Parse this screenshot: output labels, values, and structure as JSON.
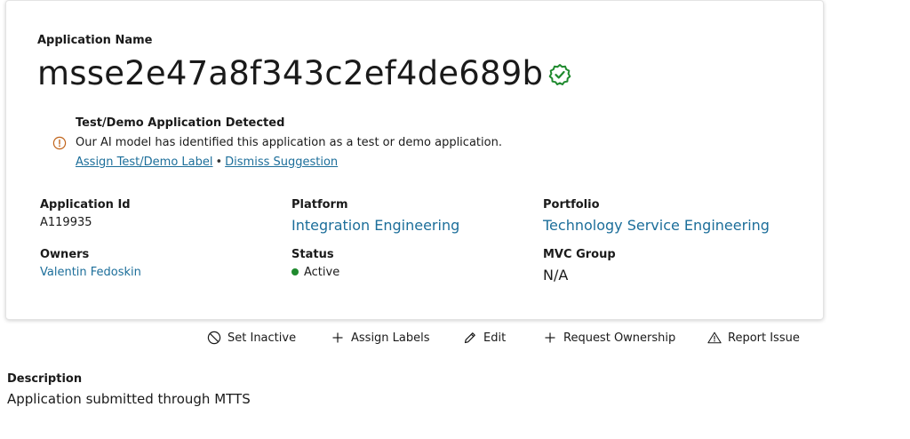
{
  "application": {
    "name_label": "Application Name",
    "name": "msse2e47a8f343c2ef4de689b"
  },
  "notice": {
    "title": "Test/Demo Application Detected",
    "text": "Our AI model has identified this application as a test or demo application.",
    "assign_link": "Assign Test/Demo Label",
    "separator": "•",
    "dismiss_link": "Dismiss Suggestion"
  },
  "fields": {
    "app_id_label": "Application Id",
    "app_id": "A119935",
    "platform_label": "Platform",
    "platform": "Integration Engineering",
    "portfolio_label": "Portfolio",
    "portfolio": "Technology Service Engineering",
    "owners_label": "Owners",
    "owners": "Valentin Fedoskin",
    "status_label": "Status",
    "status": "Active",
    "mvc_label": "MVC Group",
    "mvc": "N/A"
  },
  "actions": {
    "set_inactive": "Set Inactive",
    "assign_labels": "Assign Labels",
    "edit": "Edit",
    "request_ownership": "Request Ownership",
    "report_issue": "Report Issue"
  },
  "description": {
    "label": "Description",
    "text": "Application submitted through MTTS"
  },
  "colors": {
    "link": "#1c6e9a",
    "status_active": "#1f8a2e",
    "verified": "#1f8a2e",
    "warning": "#c0641b"
  }
}
